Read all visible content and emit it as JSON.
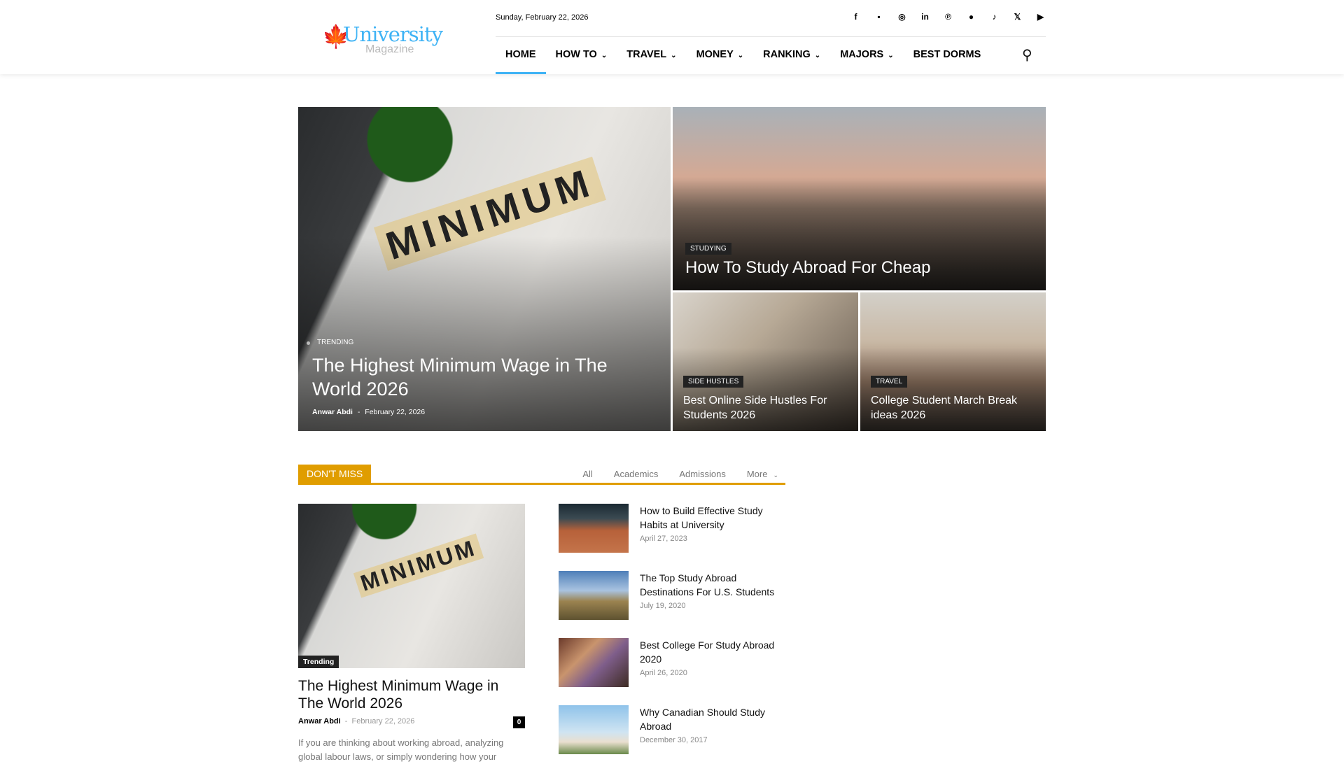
{
  "header": {
    "logo": {
      "brand": "University",
      "sub": "Magazine"
    },
    "date": "Sunday, February 22, 2026",
    "social": [
      {
        "icon": "facebook-icon",
        "glyph": "f"
      },
      {
        "icon": "flipboard-icon",
        "glyph": "▪"
      },
      {
        "icon": "instagram-icon",
        "glyph": "◎"
      },
      {
        "icon": "linkedin-icon",
        "glyph": "in"
      },
      {
        "icon": "pinterest-icon",
        "glyph": "℗"
      },
      {
        "icon": "spotify-icon",
        "glyph": "●"
      },
      {
        "icon": "tiktok-icon",
        "glyph": "♪"
      },
      {
        "icon": "x-icon",
        "glyph": "𝕏"
      },
      {
        "icon": "youtube-icon",
        "glyph": "▶"
      }
    ],
    "nav": [
      {
        "label": "HOME",
        "dropdown": false
      },
      {
        "label": "HOW TO",
        "dropdown": true
      },
      {
        "label": "TRAVEL",
        "dropdown": true
      },
      {
        "label": "MONEY",
        "dropdown": true
      },
      {
        "label": "RANKING",
        "dropdown": true
      },
      {
        "label": "MAJORS",
        "dropdown": true
      },
      {
        "label": "BEST DORMS",
        "dropdown": false
      }
    ],
    "accent": "#3fb3f5"
  },
  "hero": [
    {
      "category": "TRENDING",
      "title": "The Highest Minimum Wage in The World 2026",
      "author": "Anwar Abdi",
      "sep": "-",
      "date": "February 22, 2026"
    },
    {
      "category": "STUDYING",
      "title": "How To Study Abroad For Cheap"
    },
    {
      "category": "SIDE HUSTLES",
      "title": "Best Online Side Hustles For Students 2026"
    },
    {
      "category": "TRAVEL",
      "title": "College Student March Break ideas 2026"
    }
  ],
  "dont_miss": {
    "label": "DON'T MISS",
    "accent": "#e09d00",
    "tabs": [
      "All",
      "Academics",
      "Admissions",
      "More"
    ],
    "featured": {
      "badge": "Trending",
      "title": "The Highest Minimum Wage in The World 2026",
      "author": "Anwar Abdi",
      "sep": "-",
      "date": "February 22, 2026",
      "comments": "0",
      "excerpt": "If you are thinking about working abroad, analyzing global labour laws, or simply wondering how your"
    },
    "list": [
      {
        "title": "How to Build Effective Study Habits at University",
        "date": "April 27, 2023"
      },
      {
        "title": "The Top Study Abroad Destinations For U.S. Students",
        "date": "July 19, 2020"
      },
      {
        "title": "Best College For Study Abroad 2020",
        "date": "April 26, 2020"
      },
      {
        "title": "Why Canadian Should Study Abroad",
        "date": "December 30, 2017"
      }
    ]
  }
}
